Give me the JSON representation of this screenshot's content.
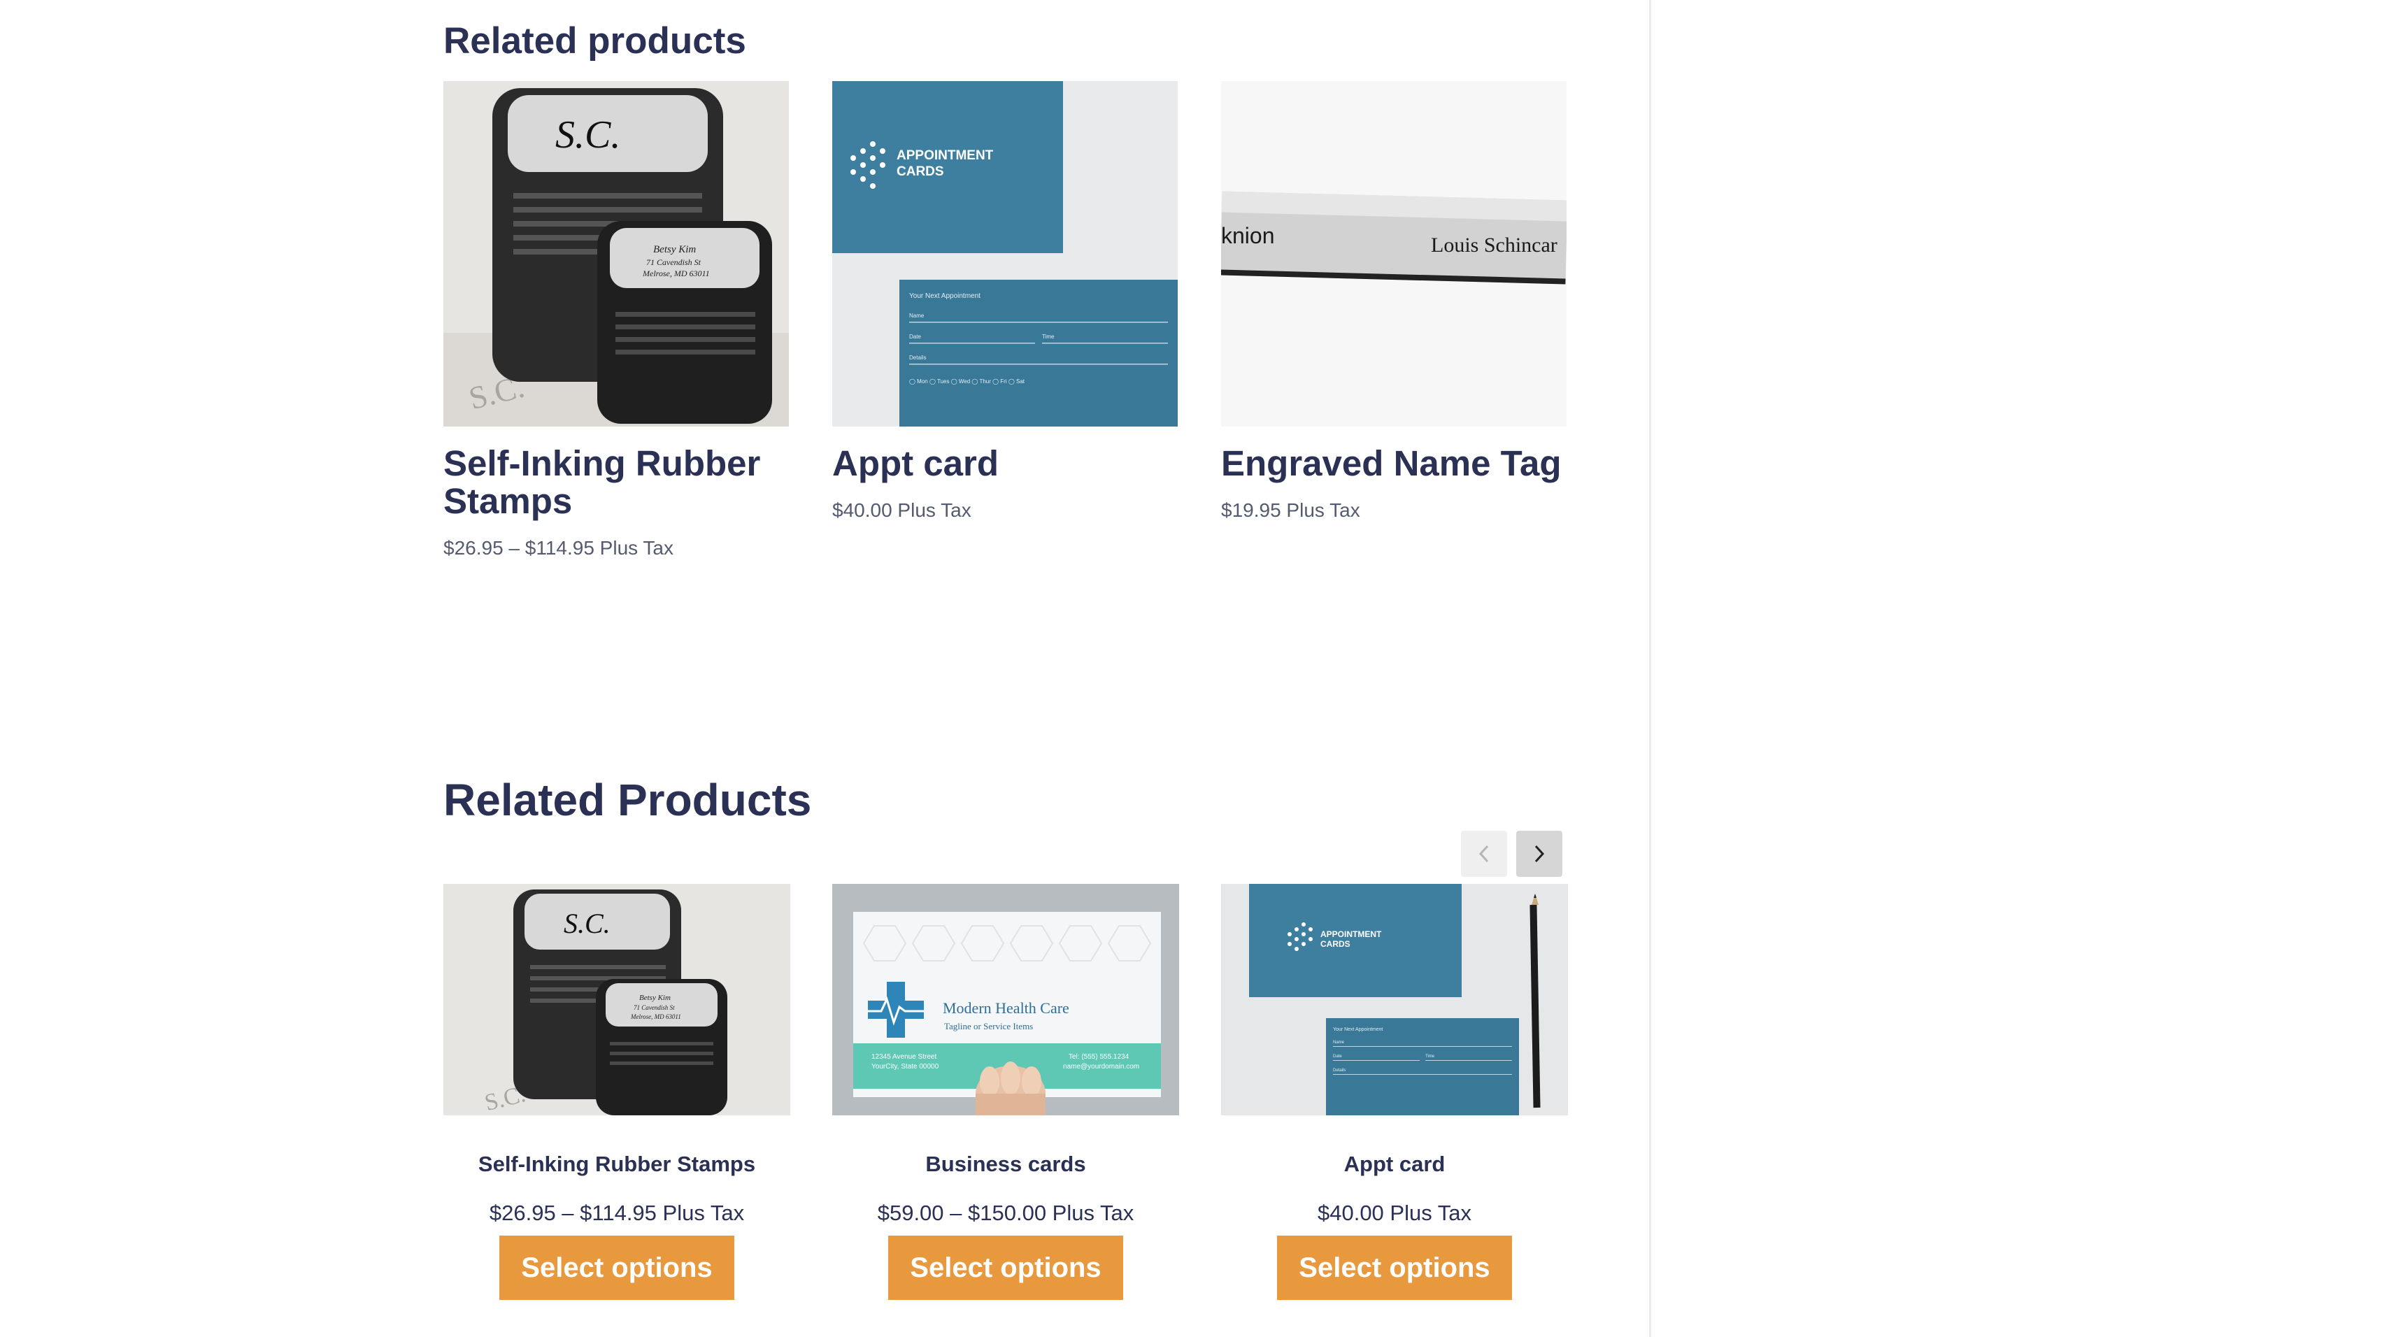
{
  "section1": {
    "heading": "Related products",
    "products": [
      {
        "title": "Self-Inking Rubber Stamps",
        "price": "$26.95 – $114.95 Plus Tax",
        "image": {
          "stamp_big": "S.C.",
          "stamp_small_name": "Betsy Kim",
          "stamp_small_l1": "71 Cavendish St",
          "stamp_small_l2": "Melrose, MD 63011",
          "impression": "S.C."
        }
      },
      {
        "title": "Appt card",
        "price": "$40.00 Plus Tax",
        "image": {
          "brand_line1": "APPOINTMENT",
          "brand_line2": "CARDS",
          "form_title": "Your Next Appointment",
          "field_name": "Name",
          "field_date": "Date",
          "field_time": "Time",
          "field_details": "Details",
          "days": "◯ Mon   ◯ Tues   ◯ Wed   ◯ Thur   ◯ Fri   ◯ Sat"
        }
      },
      {
        "title": "Engraved Name Tag",
        "price": "$19.95 Plus Tax",
        "image": {
          "tag_left": "knion",
          "tag_right": "Louis Schincar"
        }
      }
    ]
  },
  "section2": {
    "heading": "Related Products",
    "nav": {
      "prev": "previous-arrow",
      "next": "next-arrow"
    },
    "products": [
      {
        "title": "Self-Inking Rubber Stamps",
        "price": "$26.95 – $114.95 Plus Tax",
        "button": "Select options",
        "image": {
          "stamp_big": "S.C.",
          "stamp_small_name": "Betsy Kim",
          "stamp_small_l1": "71 Cavendish St",
          "stamp_small_l2": "Melrose, MD 63011",
          "impression": "S.C."
        }
      },
      {
        "title": "Business cards",
        "price": "$59.00 – $150.00 Plus Tax",
        "button": "Select options",
        "image": {
          "company": "Modern Health Care",
          "tagline": "Tagline or Service Items",
          "addr1": "12345 Avenue Street",
          "addr2": "YourCity, State 00000",
          "tel": "Tel: (555) 555.1234",
          "email": "name@yourdomain.com"
        }
      },
      {
        "title": "Appt card",
        "price": "$40.00 Plus Tax",
        "button": "Select options",
        "image": {
          "brand_line1": "APPOINTMENT",
          "brand_line2": "CARDS",
          "form_title": "Your Next Appointment",
          "field_name": "Name",
          "field_date": "Date",
          "field_time": "Time",
          "field_details": "Details"
        }
      }
    ]
  },
  "colors": {
    "heading": "#2b3055",
    "price_muted": "#555a6e",
    "button": "#e8983d",
    "card_blue": "#3e7fa0",
    "teal": "#5ec8b5"
  }
}
